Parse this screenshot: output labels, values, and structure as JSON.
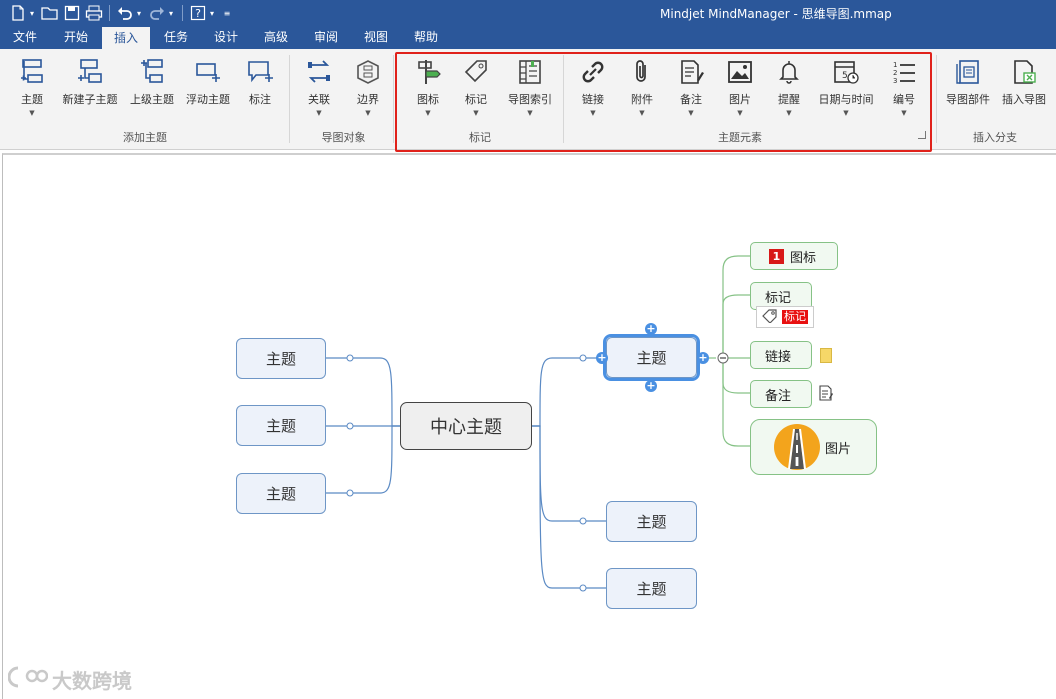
{
  "window": {
    "title": "Mindjet MindManager - 思维导图.mmap"
  },
  "menu": {
    "tabs": [
      "文件",
      "开始",
      "插入",
      "任务",
      "设计",
      "高级",
      "审阅",
      "视图",
      "帮助"
    ],
    "active": "插入"
  },
  "ribbon": {
    "buttons": {
      "topic": "主题",
      "new_subtopic": "新建子主题",
      "parent_topic": "上级主题",
      "floating_topic": "浮动主题",
      "callout": "标注",
      "relationship": "关联",
      "boundary": "边界",
      "icons": "图标",
      "tags": "标记",
      "map_index": "导图索引",
      "link": "链接",
      "attachment": "附件",
      "notes": "备注",
      "image": "图片",
      "alarm": "提醒",
      "date_time": "日期与时间",
      "numbering": "编号",
      "map_parts": "导图部件",
      "insert_map": "插入导图"
    },
    "groups": {
      "add_topic": "添加主题",
      "map_objects": "导图对象",
      "markers": "标记",
      "topic_elements": "主题元素",
      "insert_branch": "插入分支"
    }
  },
  "map": {
    "central": "中心主题",
    "left_topics": [
      "主题",
      "主题",
      "主题"
    ],
    "right_topics": [
      "主题",
      "主题",
      "主题"
    ],
    "subtopics": {
      "icon_number": "1",
      "icon": "图标",
      "tag": "标记",
      "tag_badge": "标记",
      "link": "链接",
      "notes": "备注",
      "image": "图片"
    }
  },
  "watermark": "大数跨境",
  "colors": {
    "titlebar": "#2b579a",
    "highlight": "#e0211a",
    "selection": "#4a90e2",
    "topic_border": "#6e96c6",
    "subtopic_border": "#86c286"
  }
}
